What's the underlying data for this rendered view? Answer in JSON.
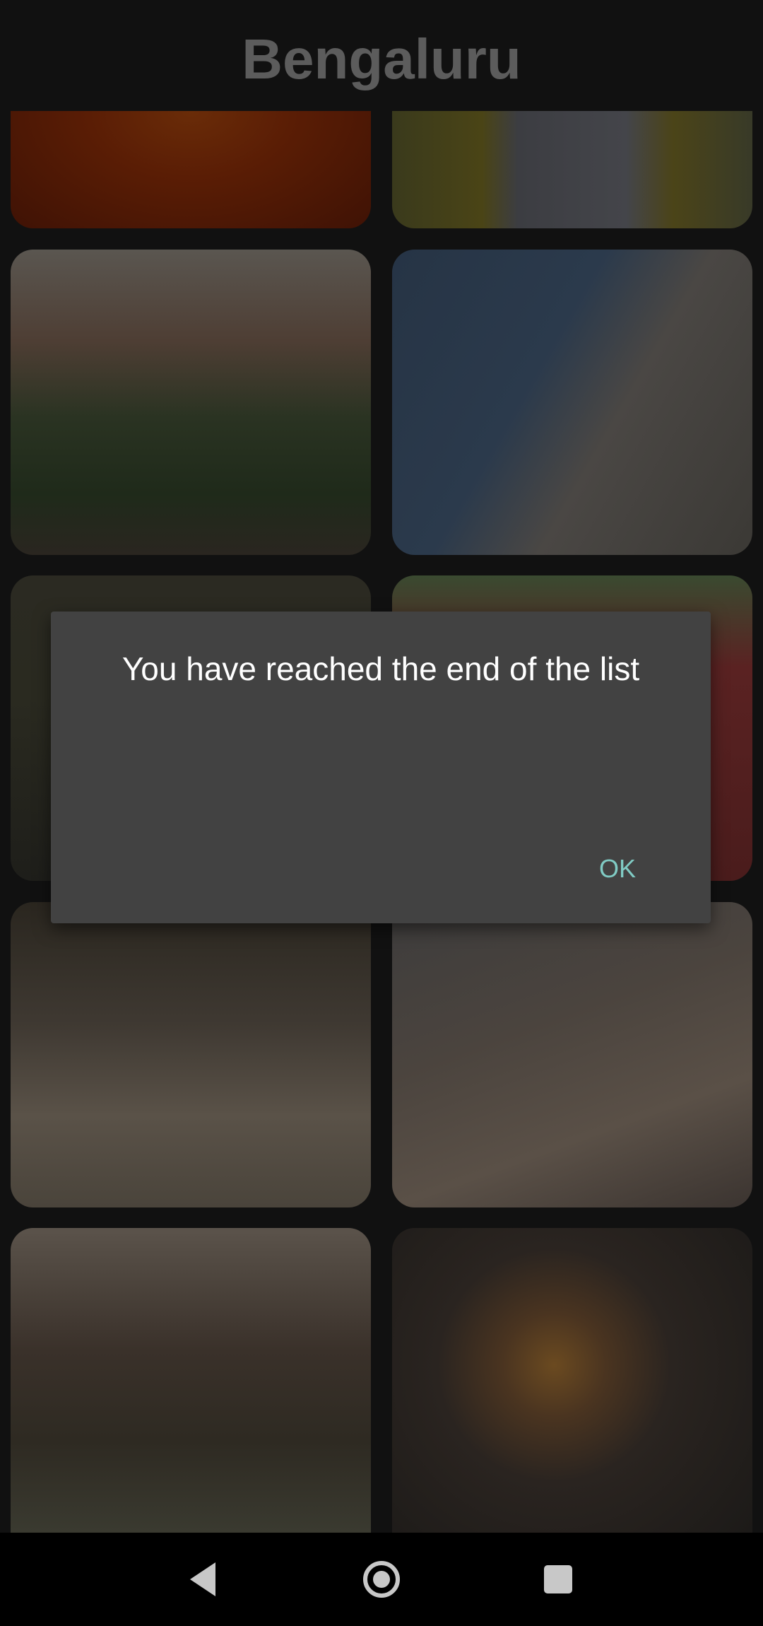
{
  "header": {
    "title": "Bengaluru"
  },
  "gallery": {
    "tile_count": 10
  },
  "dialog": {
    "message": "You have reached the end of the list",
    "ok_label": "OK",
    "accent_color": "#80cbc4"
  },
  "navbar": {
    "icons": [
      "back-icon",
      "home-icon",
      "recents-icon"
    ]
  }
}
